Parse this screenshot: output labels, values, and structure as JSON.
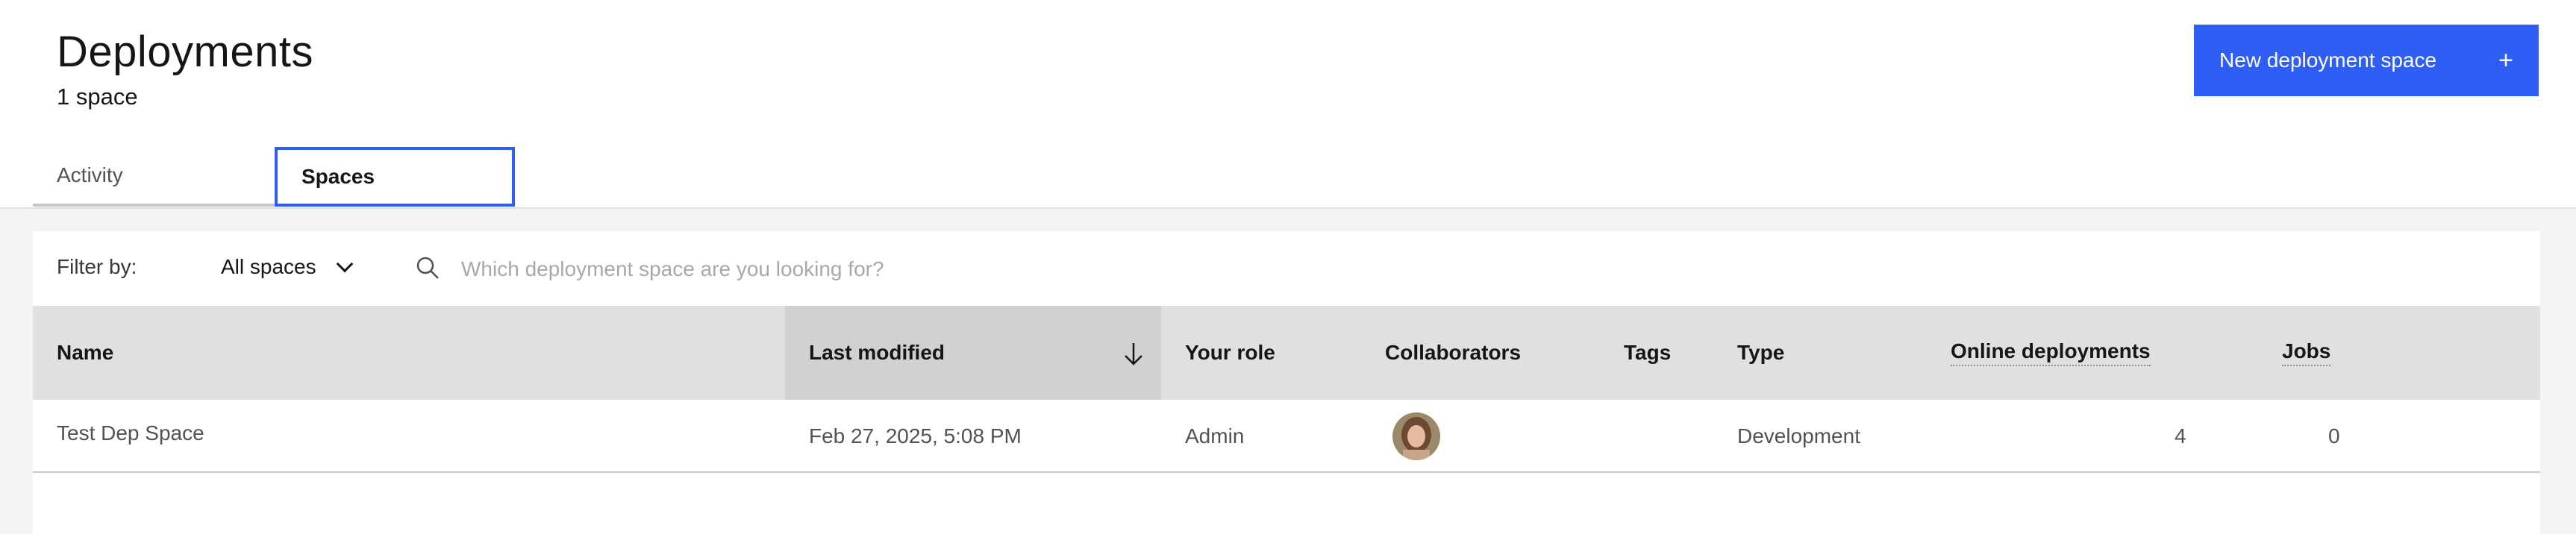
{
  "header": {
    "title": "Deployments",
    "subtitle": "1 space",
    "new_button_label": "New deployment space",
    "new_button_icon": "+"
  },
  "tabs": [
    {
      "label": "Activity",
      "selected": false
    },
    {
      "label": "Spaces",
      "selected": true
    }
  ],
  "toolbar": {
    "filter_label": "Filter by:",
    "filter_value": "All spaces",
    "search_placeholder": "Which deployment space are you looking for?",
    "search_value": ""
  },
  "table": {
    "columns": [
      "Name",
      "Last modified",
      "Your role",
      "Collaborators",
      "Tags",
      "Type",
      "Online deployments",
      "Jobs"
    ],
    "sorted_column": "Last modified",
    "sort_direction": "descending",
    "rows": [
      {
        "name": "Test Dep Space",
        "last_modified": "Feb 27, 2025, 5:08 PM",
        "role": "Admin",
        "collaborators": [
          "avatar"
        ],
        "tags": "",
        "type": "Development",
        "online_deployments": "4",
        "jobs": "0"
      }
    ]
  },
  "colors": {
    "primary": "#2f5ef5",
    "header_row": "#e0e0e0",
    "sorted_header": "#d1d1d1",
    "background": "#f4f4f4"
  }
}
